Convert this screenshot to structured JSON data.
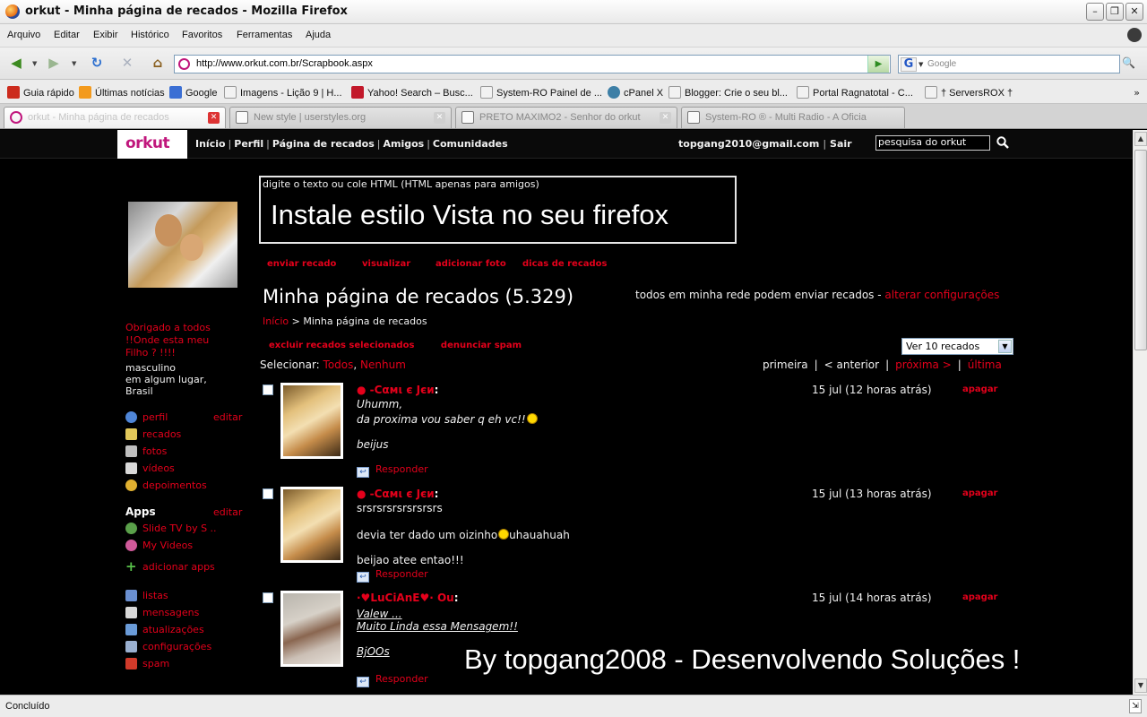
{
  "window": {
    "title": "orkut - Minha página de recados - Mozilla Firefox",
    "minimize": "–",
    "maximize": "❐",
    "close": "✕"
  },
  "menu": [
    "Arquivo",
    "Editar",
    "Exibir",
    "Histórico",
    "Favoritos",
    "Ferramentas",
    "Ajuda"
  ],
  "nav": {
    "url": "http://www.orkut.com.br/Scrapbook.aspx",
    "search_placeholder": "Google",
    "search_engine_letter": "G"
  },
  "bookmarks": [
    {
      "label": "Guia rápido",
      "color": "#cc2b1d"
    },
    {
      "label": "Últimas notícias",
      "color": "#f39a1d"
    },
    {
      "label": "Google",
      "color": "#3b6fd4"
    },
    {
      "label": "Imagens - Lição 9 | H...",
      "color": "#f2f2f2"
    },
    {
      "label": "Yahoo! Search – Busc...",
      "color": "#c2182a"
    },
    {
      "label": "System-RO Painel de ...",
      "color": "#f2f2f2"
    },
    {
      "label": "cPanel X",
      "color": "#3d7fa6"
    },
    {
      "label": "Blogger: Crie o seu bl...",
      "color": "#f2f2f2"
    },
    {
      "label": "Portal Ragnatotal - C...",
      "color": "#f2f2f2"
    },
    {
      "label": "† ServersROX †",
      "color": "#f2f2f2"
    }
  ],
  "bookmarks_more": "»",
  "tabs": [
    {
      "label": "orkut - Minha página de recados",
      "active": true
    },
    {
      "label": "New style | userstyles.org",
      "active": false
    },
    {
      "label": "PRETO MAXIMO2 - Senhor do orkut | ...",
      "active": false
    },
    {
      "label": "System-RO ® - Multi Radio - A Oficial ...",
      "active": false
    }
  ],
  "orkut": {
    "logo": "orkut",
    "topnav": [
      "Início",
      "Perfil",
      "Página de recados",
      "Amigos",
      "Comunidades"
    ],
    "account_email": "topgang2010@gmail.com",
    "logout": "Sair",
    "search_value": "pesquisa do orkut"
  },
  "profile": {
    "quote": "Obrigado a todos !!Onde esta meu Filho ? !!!!",
    "gender": "masculino",
    "location1": "em algum lugar,",
    "location2": "Brasil"
  },
  "sidebar": {
    "main_items": [
      {
        "label": "perfil",
        "edit": "editar",
        "icon": "person-icon",
        "color": "#4f86d8"
      },
      {
        "label": "recados",
        "edit": "",
        "icon": "notepad-icon",
        "color": "#e2c85a"
      },
      {
        "label": "fotos",
        "edit": "",
        "icon": "camera-icon",
        "color": "#bfbfbf"
      },
      {
        "label": "vídeos",
        "edit": "",
        "icon": "film-icon",
        "color": "#d8d8d8"
      },
      {
        "label": "depoimentos",
        "edit": "",
        "icon": "badge-icon",
        "color": "#e0b030"
      }
    ],
    "apps_title": "Apps",
    "apps_edit": "editar",
    "apps": [
      {
        "label": "Slide TV by S ..",
        "icon": "app-icon",
        "color": "#5aa04a"
      },
      {
        "label": "My Videos",
        "icon": "app-icon",
        "color": "#d05a9a"
      }
    ],
    "add_apps": "adicionar apps",
    "bottom_items": [
      {
        "label": "listas",
        "icon": "list-icon",
        "color": "#6a8fd0"
      },
      {
        "label": "mensagens",
        "icon": "envelope-icon",
        "color": "#d8d8d8"
      },
      {
        "label": "atualizações",
        "icon": "updates-icon",
        "color": "#6a9bd8"
      },
      {
        "label": "configurações",
        "icon": "wrench-icon",
        "color": "#9ab0d0"
      },
      {
        "label": "spam",
        "icon": "spam-icon",
        "color": "#d03a2a"
      }
    ]
  },
  "composer": {
    "hint": "digite o texto ou cole HTML (HTML apenas para amigos)",
    "text": "Instale estilo Vista no seu firefox"
  },
  "actions": [
    "enviar recado",
    "visualizar",
    "adicionar foto",
    "dicas de recados"
  ],
  "scrapbook": {
    "title": "Minha página de recados (5.329)",
    "permission_text": "todos em minha rede podem enviar recados - ",
    "permission_link": "alterar configurações",
    "breadcrumb_home": "Início",
    "breadcrumb_sep": ">",
    "breadcrumb_current": "Minha página de recados",
    "delete_selected": "excluir recados selecionados",
    "report_spam": "denunciar spam",
    "per_page": "Ver 10 recados",
    "select_label": "Selecionar:",
    "select_all": "Todos",
    "select_none": "Nenhum",
    "pager": {
      "first": "primeira",
      "prev": "< anterior",
      "next": "próxima >",
      "last": "última"
    }
  },
  "scraps": [
    {
      "author": "● -Cαмι є Jєи",
      "time": "15 jul (12 horas atrás)",
      "delete": "apagar",
      "reply": "Responder",
      "lines": [
        "Uhumm,",
        "da proxima vou saber q eh vc!!",
        "beijus"
      ]
    },
    {
      "author": "● -Cαмι є Jєи",
      "time": "15 jul (13 horas atrás)",
      "delete": "apagar",
      "reply": "Responder",
      "lines": [
        "srsrsrsrsrsrsrsrs",
        "devia ter dado um oizinho",
        "uhauahuah",
        "beijao atee entao!!!"
      ]
    },
    {
      "author": "·♥LuCiAnE♥·  Ou",
      "time": "15 jul (14 horas atrás)",
      "delete": "apagar",
      "reply": "Responder",
      "lines": [
        "Valew ...",
        "Muito Linda essa Mensagem!!",
        "BjOOs"
      ]
    }
  ],
  "watermark": "By topgang2008 - Desenvolvendo Soluções !",
  "status": "Concluído"
}
